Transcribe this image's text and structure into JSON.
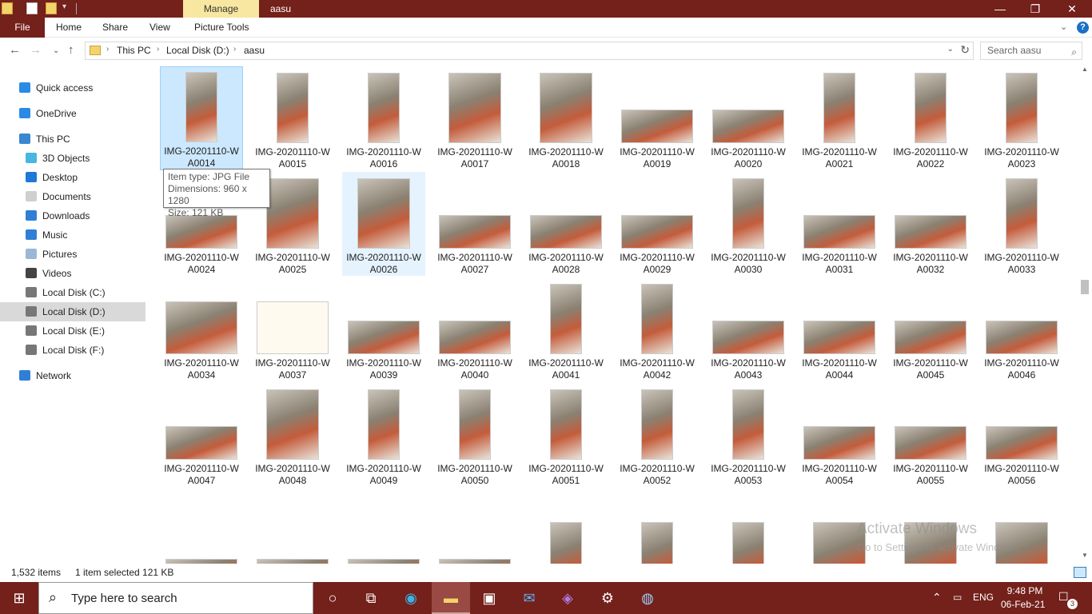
{
  "titlebar": {
    "context_tab": "Manage",
    "window_title": "aasu",
    "controls": {
      "minimize": "—",
      "restore": "❐",
      "close": "✕"
    }
  },
  "ribbon": {
    "file": "File",
    "tabs": [
      "Home",
      "Share",
      "View",
      "Picture Tools"
    ],
    "help": "?"
  },
  "address": {
    "crumbs": [
      "This PC",
      "Local Disk (D:)",
      "aasu"
    ],
    "search_placeholder": "Search aasu"
  },
  "sidebar": {
    "items": [
      {
        "label": "Quick access",
        "icon": "star-icon",
        "color": "#2b8ae6"
      },
      {
        "label": "OneDrive",
        "icon": "cloud-icon",
        "color": "#2b8ae6"
      },
      {
        "label": "This PC",
        "icon": "monitor-icon",
        "color": "#3a86d0"
      },
      {
        "label": "3D Objects",
        "icon": "cube-icon",
        "color": "#45b7e0"
      },
      {
        "label": "Desktop",
        "icon": "desktop-icon",
        "color": "#1e78d8"
      },
      {
        "label": "Documents",
        "icon": "document-icon",
        "color": "#cfcfcf"
      },
      {
        "label": "Downloads",
        "icon": "download-icon",
        "color": "#2f7fd6"
      },
      {
        "label": "Music",
        "icon": "music-icon",
        "color": "#2f7fd6"
      },
      {
        "label": "Pictures",
        "icon": "pictures-icon",
        "color": "#9bb7d8"
      },
      {
        "label": "Videos",
        "icon": "videos-icon",
        "color": "#444"
      },
      {
        "label": "Local Disk (C:)",
        "icon": "drive-icon",
        "color": "#777"
      },
      {
        "label": "Local Disk (D:)",
        "icon": "drive-icon",
        "color": "#777",
        "selected": true
      },
      {
        "label": "Local Disk (E:)",
        "icon": "drive-icon",
        "color": "#777"
      },
      {
        "label": "Local Disk (F:)",
        "icon": "drive-icon",
        "color": "#777"
      },
      {
        "label": "Network",
        "icon": "network-icon",
        "color": "#2f7fd6"
      }
    ]
  },
  "files": [
    {
      "line1": "IMG-20201110-W",
      "line2": "A0014",
      "orient": "p",
      "state": "selected"
    },
    {
      "line1": "IMG-20201110-W",
      "line2": "A0015",
      "orient": "p"
    },
    {
      "line1": "IMG-20201110-W",
      "line2": "A0016",
      "orient": "p"
    },
    {
      "line1": "IMG-20201110-W",
      "line2": "A0017",
      "orient": "s"
    },
    {
      "line1": "IMG-20201110-W",
      "line2": "A0018",
      "orient": "s"
    },
    {
      "line1": "IMG-20201110-W",
      "line2": "A0019",
      "orient": "l"
    },
    {
      "line1": "IMG-20201110-W",
      "line2": "A0020",
      "orient": "l"
    },
    {
      "line1": "IMG-20201110-W",
      "line2": "A0021",
      "orient": "p"
    },
    {
      "line1": "IMG-20201110-W",
      "line2": "A0022",
      "orient": "p"
    },
    {
      "line1": "IMG-20201110-W",
      "line2": "A0023",
      "orient": "p"
    },
    {
      "line1": "IMG-20201110-W",
      "line2": "A0024",
      "orient": "l"
    },
    {
      "line1": "IMG-20201110-W",
      "line2": "A0025",
      "orient": "s"
    },
    {
      "line1": "IMG-20201110-W",
      "line2": "A0026",
      "orient": "s",
      "state": "hover"
    },
    {
      "line1": "IMG-20201110-W",
      "line2": "A0027",
      "orient": "l"
    },
    {
      "line1": "IMG-20201110-W",
      "line2": "A0028",
      "orient": "l"
    },
    {
      "line1": "IMG-20201110-W",
      "line2": "A0029",
      "orient": "l"
    },
    {
      "line1": "IMG-20201110-W",
      "line2": "A0030",
      "orient": "p"
    },
    {
      "line1": "IMG-20201110-W",
      "line2": "A0031",
      "orient": "l"
    },
    {
      "line1": "IMG-20201110-W",
      "line2": "A0032",
      "orient": "l"
    },
    {
      "line1": "IMG-20201110-W",
      "line2": "A0033",
      "orient": "p"
    },
    {
      "line1": "IMG-20201110-W",
      "line2": "A0034",
      "orient": "m"
    },
    {
      "line1": "IMG-20201110-W",
      "line2": "A0037",
      "orient": "d"
    },
    {
      "line1": "IMG-20201110-W",
      "line2": "A0039",
      "orient": "l"
    },
    {
      "line1": "IMG-20201110-W",
      "line2": "A0040",
      "orient": "l"
    },
    {
      "line1": "IMG-20201110-W",
      "line2": "A0041",
      "orient": "p"
    },
    {
      "line1": "IMG-20201110-W",
      "line2": "A0042",
      "orient": "p"
    },
    {
      "line1": "IMG-20201110-W",
      "line2": "A0043",
      "orient": "l"
    },
    {
      "line1": "IMG-20201110-W",
      "line2": "A0044",
      "orient": "l"
    },
    {
      "line1": "IMG-20201110-W",
      "line2": "A0045",
      "orient": "l"
    },
    {
      "line1": "IMG-20201110-W",
      "line2": "A0046",
      "orient": "l"
    },
    {
      "line1": "IMG-20201110-W",
      "line2": "A0047",
      "orient": "l"
    },
    {
      "line1": "IMG-20201110-W",
      "line2": "A0048",
      "orient": "s"
    },
    {
      "line1": "IMG-20201110-W",
      "line2": "A0049",
      "orient": "p"
    },
    {
      "line1": "IMG-20201110-W",
      "line2": "A0050",
      "orient": "p"
    },
    {
      "line1": "IMG-20201110-W",
      "line2": "A0051",
      "orient": "p"
    },
    {
      "line1": "IMG-20201110-W",
      "line2": "A0052",
      "orient": "p"
    },
    {
      "line1": "IMG-20201110-W",
      "line2": "A0053",
      "orient": "p"
    },
    {
      "line1": "IMG-20201110-W",
      "line2": "A0054",
      "orient": "l"
    },
    {
      "line1": "IMG-20201110-W",
      "line2": "A0055",
      "orient": "l"
    },
    {
      "line1": "IMG-20201110-W",
      "line2": "A0056",
      "orient": "l"
    },
    {
      "line1": "",
      "line2": "",
      "orient": "l"
    },
    {
      "line1": "",
      "line2": "",
      "orient": "l"
    },
    {
      "line1": "",
      "line2": "",
      "orient": "l"
    },
    {
      "line1": "",
      "line2": "",
      "orient": "l"
    },
    {
      "line1": "",
      "line2": "",
      "orient": "p"
    },
    {
      "line1": "",
      "line2": "",
      "orient": "p"
    },
    {
      "line1": "",
      "line2": "",
      "orient": "p"
    },
    {
      "line1": "",
      "line2": "",
      "orient": "s"
    },
    {
      "line1": "",
      "line2": "",
      "orient": "s"
    },
    {
      "line1": "",
      "line2": "",
      "orient": "s"
    }
  ],
  "tooltip": {
    "type": "Item type: JPG File",
    "dimensions": "Dimensions: 960 x 1280",
    "size": "Size: 121 KB"
  },
  "watermark": {
    "line1": "Activate Windows",
    "line2": "Go to Settings to activate Windows."
  },
  "status": {
    "items": "1,532 items",
    "selected": "1 item selected  121 KB"
  },
  "taskbar": {
    "search_placeholder": "Type here to search",
    "language": "ENG",
    "time": "9:48 PM",
    "date": "06-Feb-21",
    "notification_count": "3",
    "accent": "#74201b"
  }
}
